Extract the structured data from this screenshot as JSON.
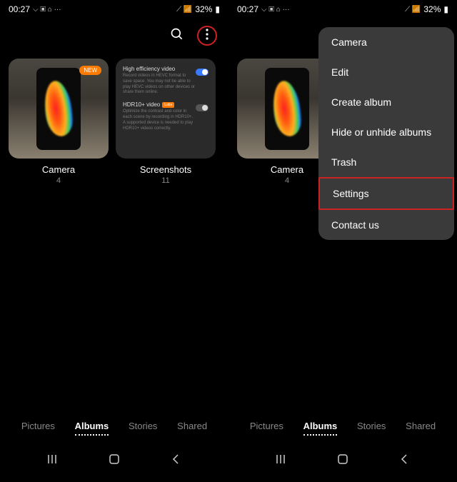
{
  "status": {
    "time": "00:27",
    "left_icons": "⌵ ▣ ⌂ ···",
    "right_icons": "⟋ 📶",
    "battery": "32%",
    "battery_icon": "▮"
  },
  "left_panel": {
    "albums": [
      {
        "label": "Camera",
        "count": "4",
        "badge": "NEW"
      },
      {
        "label": "Screenshots",
        "count": "11"
      }
    ],
    "screenshot_settings": {
      "hev": {
        "title": "High efficiency video",
        "desc": "Record videos in HEVC format to save space. You may not be able to play HEVC videos on other devices or share them online."
      },
      "hdr": {
        "title": "HDR10+ video",
        "badge": "Labs",
        "desc": "Optimize the contrast and color in each scene by recording in HDR10+. A supported device is needed to play HDR10+ videos correctly."
      }
    }
  },
  "right_panel": {
    "albums": [
      {
        "label": "Camera",
        "count": "4"
      }
    ],
    "menu": [
      "Camera",
      "Edit",
      "Create album",
      "Hide or unhide albums",
      "Trash",
      "Settings",
      "Contact us"
    ]
  },
  "tabs": [
    "Pictures",
    "Albums",
    "Stories",
    "Shared"
  ],
  "active_tab": "Albums"
}
